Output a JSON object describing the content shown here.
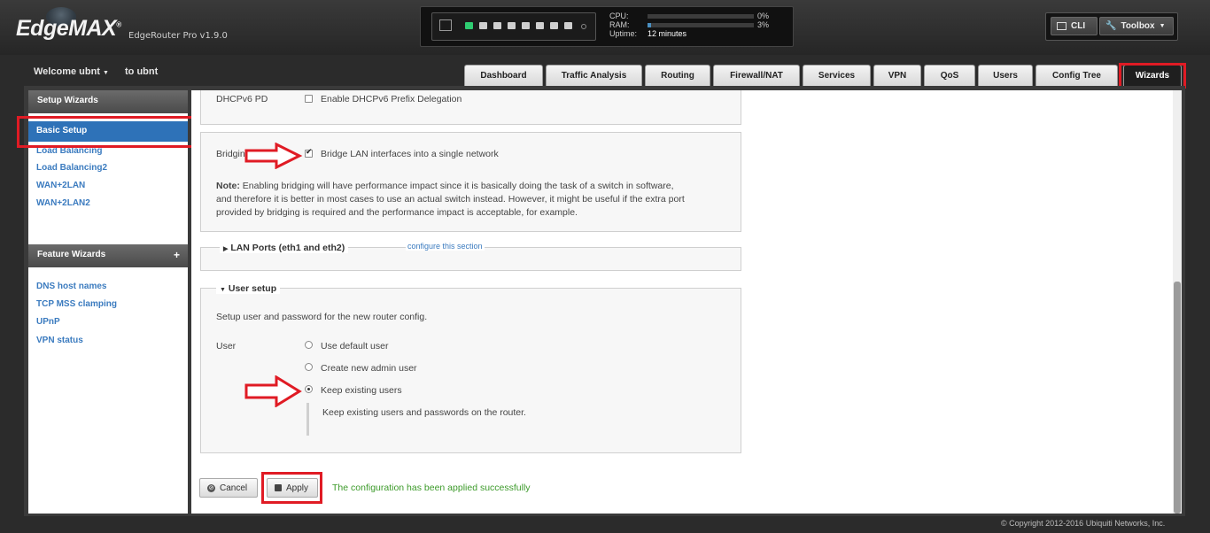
{
  "header": {
    "logo": "EdgeMAX",
    "logo_mark": "®",
    "model": "EdgeRouter Pro v1.9.0",
    "cpu_label": "CPU:",
    "ram_label": "RAM:",
    "uptime_label": "Uptime:",
    "cpu_value": "0%",
    "ram_value": "3%",
    "cpu_fraction": 0.0,
    "ram_fraction": 0.03,
    "uptime_value": "12 minutes",
    "cli_label": "CLI",
    "toolbox_label": "Toolbox"
  },
  "user": {
    "welcome": "Welcome ubnt",
    "to_ubnt": "to ubnt"
  },
  "tabs": [
    {
      "label": "Dashboard"
    },
    {
      "label": "Traffic Analysis"
    },
    {
      "label": "Routing"
    },
    {
      "label": "Firewall/NAT"
    },
    {
      "label": "Services"
    },
    {
      "label": "VPN"
    },
    {
      "label": "QoS"
    },
    {
      "label": "Users"
    },
    {
      "label": "Config Tree"
    },
    {
      "label": "Wizards"
    }
  ],
  "sidebar": {
    "setup_title": "Setup Wizards",
    "setup_items": [
      "Basic Setup",
      "Load Balancing",
      "Load Balancing2",
      "WAN+2LAN",
      "WAN+2LAN2"
    ],
    "feature_title": "Feature Wizards",
    "feature_plus": "+",
    "feature_items": [
      "DNS host names",
      "TCP MSS clamping",
      "UPnP",
      "VPN status"
    ]
  },
  "content": {
    "dhcpv6_label": "DHCPv6 PD",
    "dhcpv6_option": "Enable DHCPv6 Prefix Delegation",
    "bridging_label": "Bridging",
    "bridging_option": "Bridge LAN interfaces into a single network",
    "note_bold": "Note:",
    "note_line1": "Enabling bridging will have performance impact since it is basically doing the task of a switch in software,",
    "note_line2": "and therefore it is better in most cases to use an actual switch instead. However, it might be useful if the extra port",
    "note_line3": "provided by bridging is required and the performance impact is acceptable, for example.",
    "lan_ports_title": "LAN Ports (eth1 and eth2)",
    "lan_ports_link": "configure this section",
    "user_setup_title": "User setup",
    "user_setup_desc": "Setup user and password for the new router config.",
    "user_label": "User",
    "user_options": [
      "Use default user",
      "Create new admin user",
      "Keep existing users"
    ],
    "keep_desc": "Keep existing users and passwords on the router.",
    "cancel_label": "Cancel",
    "apply_label": "Apply",
    "success_message": "The configuration has been applied successfully"
  },
  "footer": {
    "copyright": "© Copyright 2012-2016 Ubiquiti Networks, Inc."
  },
  "colors": {
    "annotation_red": "#e01b24",
    "link_blue": "#3b7bbf",
    "success_green": "#3c9a2a",
    "port_active_green": "#2ecc71"
  }
}
